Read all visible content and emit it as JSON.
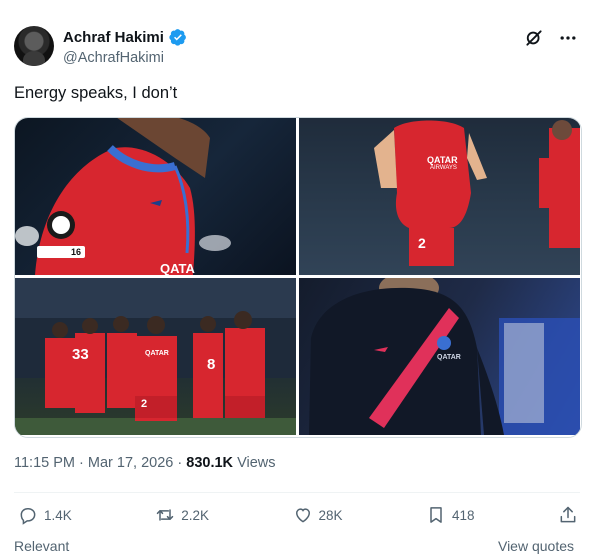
{
  "author": {
    "name": "Achraf Hakimi",
    "handle": "@AchrafHakimi",
    "verified": true
  },
  "tweet": {
    "text": "Energy speaks, I don’t"
  },
  "media": {
    "image1": {
      "badge_text": "16",
      "shirt_text": "QATA"
    },
    "image2": {
      "sponsor_main": "QATAR",
      "sponsor_sub": "AIRWAYS",
      "number": "2"
    },
    "image3": {
      "sponsor_main": "QATAR",
      "number_left": "33",
      "number_center": "2",
      "number_right": "8"
    },
    "image4": {
      "sponsor_text": "QATAR"
    }
  },
  "meta": {
    "time": "11:15 PM",
    "sep1": "·",
    "date": "Mar 17, 2026",
    "sep2": "·",
    "views_count": "830.1K",
    "views_label": "Views"
  },
  "actions": {
    "replies": "1.4K",
    "reposts": "2.2K",
    "likes": "28K",
    "bookmarks": "418"
  },
  "footer": {
    "relevant": "Relevant",
    "view_quotes": "View quotes"
  },
  "colors": {
    "verified": "#1d9bf0",
    "text": "#0f1419",
    "secondary": "#536471",
    "kit_red": "#d7262f"
  }
}
